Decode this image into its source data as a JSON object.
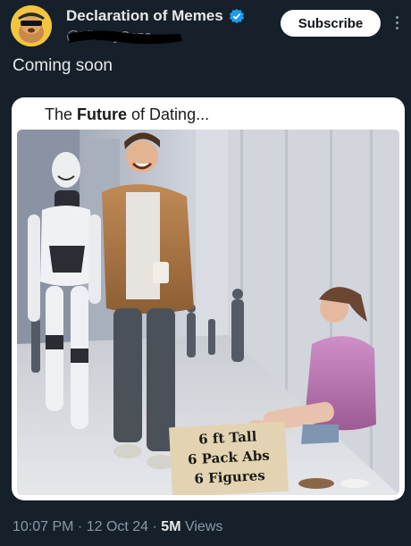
{
  "account": {
    "display_name": "Declaration of Memes",
    "handle": "@LibertyCons",
    "verified_icon": "verified-badge-icon",
    "avatar_icon": "meme-avatar-icon"
  },
  "actions": {
    "subscribe_label": "Subscribe",
    "more_icon": "more-options-icon"
  },
  "tweet": {
    "text": "Coming soon"
  },
  "media": {
    "caption_prefix": "The ",
    "caption_bold": "Future",
    "caption_suffix": " of Dating...",
    "sign_lines": [
      "6 ft Tall",
      "6 Pack Abs",
      "6 Figures"
    ]
  },
  "meta": {
    "time": "10:07 PM",
    "separator1": " · ",
    "date": "12 Oct 24",
    "separator2": " · ",
    "views_count": "5M",
    "views_label": " Views"
  },
  "colors": {
    "background": "#15202b",
    "verified": "#1d9bf0",
    "muted_text": "#8b98a5",
    "primary_text": "#e7e9ea"
  }
}
